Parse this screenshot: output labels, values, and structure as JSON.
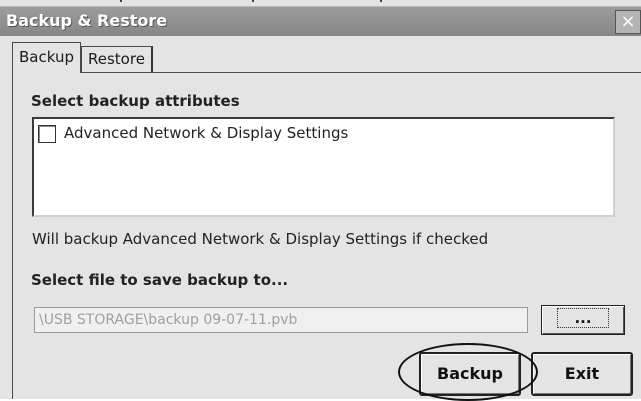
{
  "window": {
    "title": "Backup & Restore",
    "close_glyph": "×"
  },
  "tabs": [
    {
      "label": "Backup",
      "active": true
    },
    {
      "label": "Restore",
      "active": false
    }
  ],
  "attributes": {
    "heading": "Select backup attributes",
    "items": [
      {
        "label": "Advanced Network & Display Settings",
        "checked": false
      }
    ],
    "hint": "Will backup Advanced Network & Display Settings if checked"
  },
  "file": {
    "heading": "Select file to save backup to...",
    "path": "\\USB STORAGE\\backup 09-07-11.pvb",
    "browse_label": "..."
  },
  "actions": {
    "backup_label": "Backup",
    "exit_label": "Exit"
  },
  "colors": {
    "titlebar": "#8f8f8f",
    "window_bg": "#e4e4e4",
    "disabled_text": "#a0a0a0"
  }
}
